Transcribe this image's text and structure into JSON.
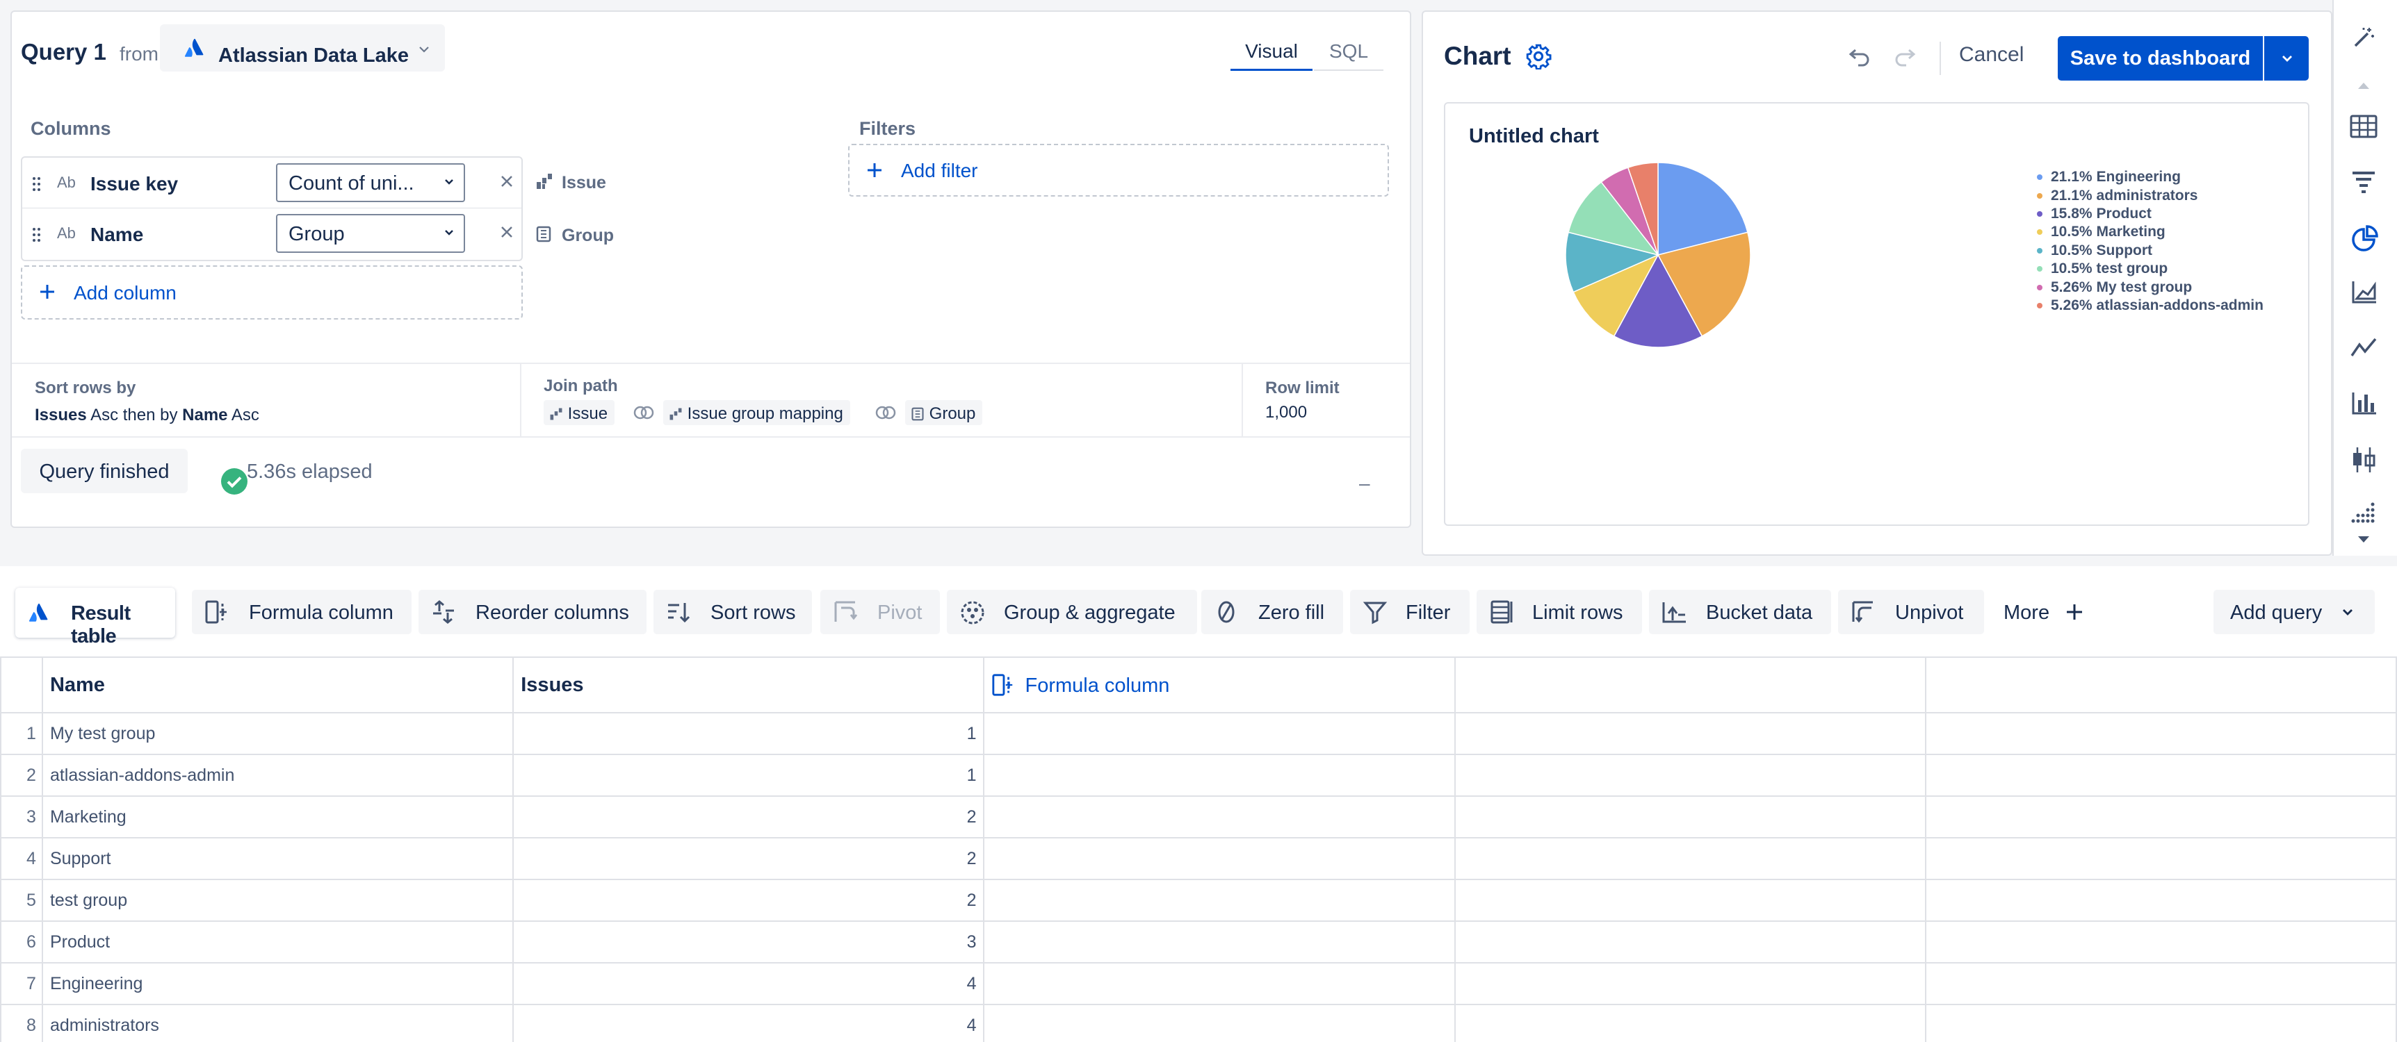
{
  "query": {
    "title": "Query 1",
    "from_label": "from",
    "source": "Atlassian Data Lake",
    "mode_tabs": [
      "Visual",
      "SQL"
    ],
    "columns_heading": "Columns",
    "filters_heading": "Filters",
    "columns": [
      {
        "type_badge": "Ab",
        "name": "Issue key",
        "aggregation": "Count of uni...",
        "table": "Issue"
      },
      {
        "type_badge": "Ab",
        "name": "Name",
        "aggregation": "Group",
        "table": "Group"
      }
    ],
    "add_column": "Add column",
    "add_filter": "Add filter",
    "sort_heading": "Sort rows by",
    "sort_field_1": "Issues",
    "sort_mid": "Asc then by",
    "sort_field_2": "Name",
    "sort_dir_2": "Asc",
    "join_heading": "Join path",
    "join_path": [
      "Issue",
      "Issue group mapping",
      "Group"
    ],
    "row_limit_heading": "Row limit",
    "row_limit": "1,000",
    "status": "Query finished",
    "elapsed": "5.36s elapsed",
    "collapse_glyph": "–"
  },
  "chart": {
    "panel_title": "Chart",
    "cancel": "Cancel",
    "save": "Save to dashboard",
    "card_title": "Untitled chart"
  },
  "chart_data": {
    "type": "pie",
    "title": "Untitled chart",
    "legend_position": "right",
    "slices": [
      {
        "label": "Engineering",
        "percent_label": "21.1%",
        "value": 4,
        "color": "#6b9cf0"
      },
      {
        "label": "administrators",
        "percent_label": "21.1%",
        "value": 4,
        "color": "#eda84e"
      },
      {
        "label": "Product",
        "percent_label": "15.8%",
        "value": 3,
        "color": "#6e5dc6"
      },
      {
        "label": "Marketing",
        "percent_label": "10.5%",
        "value": 2,
        "color": "#efcd5a"
      },
      {
        "label": "Support",
        "percent_label": "10.5%",
        "value": 2,
        "color": "#5bb4c8"
      },
      {
        "label": "test group",
        "percent_label": "10.5%",
        "value": 2,
        "color": "#94dfb7"
      },
      {
        "label": "My test group",
        "percent_label": "5.26%",
        "value": 1,
        "color": "#d16cb0"
      },
      {
        "label": "atlassian-addons-admin",
        "percent_label": "5.26%",
        "value": 1,
        "color": "#e8806a"
      }
    ]
  },
  "toolbar": {
    "result_table": "Result table",
    "formula_column": "Formula column",
    "reorder_columns": "Reorder columns",
    "sort_rows": "Sort rows",
    "pivot": "Pivot",
    "group_aggregate": "Group & aggregate",
    "zero_fill": "Zero fill",
    "filter": "Filter",
    "limit_rows": "Limit rows",
    "bucket_data": "Bucket data",
    "unpivot": "Unpivot",
    "more": "More",
    "add_query": "Add query"
  },
  "table": {
    "headers": [
      "Name",
      "Issues",
      "Formula column",
      "",
      ""
    ],
    "rows": [
      {
        "idx": "1",
        "name": "My test group",
        "issues": "1"
      },
      {
        "idx": "2",
        "name": "atlassian-addons-admin",
        "issues": "1"
      },
      {
        "idx": "3",
        "name": "Marketing",
        "issues": "2"
      },
      {
        "idx": "4",
        "name": "Support",
        "issues": "2"
      },
      {
        "idx": "5",
        "name": "test group",
        "issues": "2"
      },
      {
        "idx": "6",
        "name": "Product",
        "issues": "3"
      },
      {
        "idx": "7",
        "name": "Engineering",
        "issues": "4"
      },
      {
        "idx": "8",
        "name": "administrators",
        "issues": "4"
      }
    ]
  },
  "colors": {
    "brand": "#0052cc",
    "success": "#36b37e",
    "border": "#dfe1e6"
  }
}
